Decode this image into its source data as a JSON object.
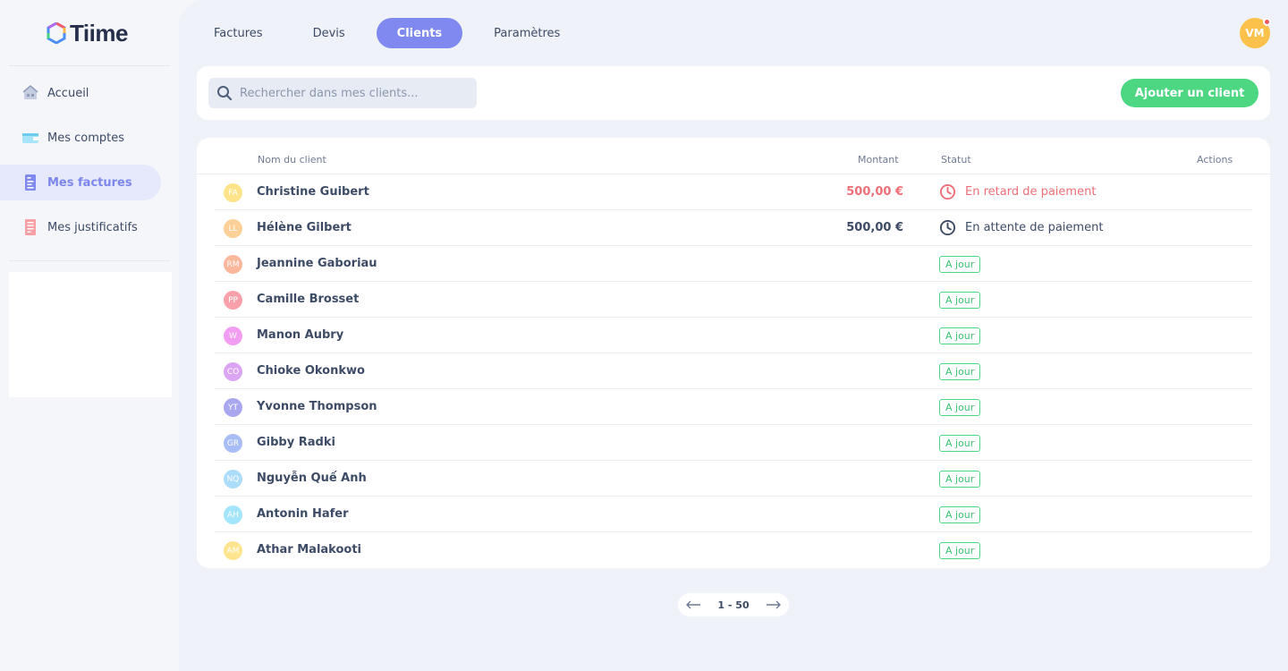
{
  "brand": {
    "name": "Tiime"
  },
  "sidebar": {
    "items": [
      {
        "label": "Accueil",
        "icon": "home-icon",
        "active": false
      },
      {
        "label": "Mes comptes",
        "icon": "wallet-icon",
        "active": false
      },
      {
        "label": "Mes factures",
        "icon": "invoice-icon",
        "active": true
      },
      {
        "label": "Mes justificatifs",
        "icon": "receipt-icon",
        "active": false
      }
    ]
  },
  "header": {
    "tabs": [
      {
        "label": "Factures",
        "active": false
      },
      {
        "label": "Devis",
        "active": false
      },
      {
        "label": "Clients",
        "active": true
      },
      {
        "label": "Paramètres",
        "active": false
      }
    ],
    "user_initials": "VM"
  },
  "search": {
    "placeholder": "Rechercher dans mes clients...",
    "value": ""
  },
  "actions": {
    "add_client_label": "Ajouter un client"
  },
  "table": {
    "columns": {
      "name": "Nom du client",
      "amount": "Montant",
      "status": "Statut",
      "actions": "Actions"
    },
    "rows": [
      {
        "initials": "FA",
        "color": "#fde38a",
        "name": "Christine Guibert",
        "amount": "500,00 €",
        "status": "En retard de paiement",
        "status_type": "late"
      },
      {
        "initials": "LL",
        "color": "#fcd096",
        "name": "Hélène Gilbert",
        "amount": "500,00 €",
        "status": "En attente de paiement",
        "status_type": "pending"
      },
      {
        "initials": "RM",
        "color": "#fbb79b",
        "name": "Jeannine Gaboriau",
        "amount": "",
        "status": "A jour",
        "status_type": "ok"
      },
      {
        "initials": "PP",
        "color": "#f8a1aa",
        "name": "Camille Brosset",
        "amount": "",
        "status": "A jour",
        "status_type": "ok"
      },
      {
        "initials": "W",
        "color": "#f29df1",
        "name": "Manon Aubry",
        "amount": "",
        "status": "A jour",
        "status_type": "ok"
      },
      {
        "initials": "CO",
        "color": "#dca5f3",
        "name": "Chioke Okonkwo",
        "amount": "",
        "status": "A jour",
        "status_type": "ok"
      },
      {
        "initials": "YT",
        "color": "#a9a7ef",
        "name": "Yvonne Thompson",
        "amount": "",
        "status": "A jour",
        "status_type": "ok"
      },
      {
        "initials": "GR",
        "color": "#a8bdf5",
        "name": "Gibby Radki",
        "amount": "",
        "status": "A jour",
        "status_type": "ok"
      },
      {
        "initials": "NQ",
        "color": "#abdcfa",
        "name": "Nguyễn Quế Anh",
        "amount": "",
        "status": "A jour",
        "status_type": "ok"
      },
      {
        "initials": "AH",
        "color": "#a3e6fb",
        "name": "Antonin Hafer",
        "amount": "",
        "status": "A jour",
        "status_type": "ok"
      },
      {
        "initials": "AM",
        "color": "#fde48e",
        "name": "Athar Malakooti",
        "amount": "",
        "status": "A jour",
        "status_type": "ok"
      }
    ]
  },
  "pagination": {
    "range": "1 - 50"
  },
  "colors": {
    "accent": "#7f89ef",
    "success": "#4ed783",
    "danger": "#ee6f78",
    "avatar": "#fbc14a"
  }
}
